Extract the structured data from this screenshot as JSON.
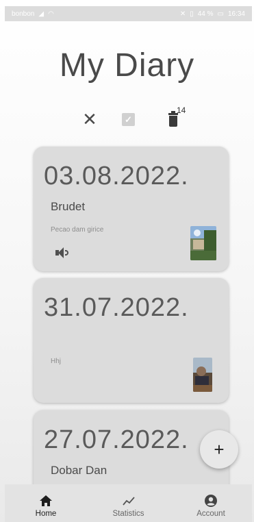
{
  "status_bar": {
    "carrier": "bonbon",
    "battery": "44 %",
    "time": "16:34"
  },
  "page": {
    "title": "My Diary"
  },
  "toolbar": {
    "close_icon": "close-icon",
    "select_all_icon": "checkbox-icon",
    "delete_icon": "trash-icon",
    "delete_count": "14"
  },
  "entries": [
    {
      "date": "03.08.2022.",
      "title": "Brudet",
      "text": "Pecao dam girice",
      "has_audio": true,
      "has_image": true
    },
    {
      "date": "31.07.2022.",
      "title": "",
      "text": "Hhj",
      "has_audio": false,
      "has_image": true
    },
    {
      "date": "27.07.2022.",
      "title": "Dobar Dan",
      "text": "",
      "has_audio": false,
      "has_image": false
    }
  ],
  "fab": {
    "label": "+"
  },
  "bottom_nav": {
    "items": [
      {
        "label": "Home",
        "icon": "home-icon",
        "active": true
      },
      {
        "label": "Statistics",
        "icon": "chart-line-icon",
        "active": false
      },
      {
        "label": "Account",
        "icon": "account-circle-icon",
        "active": false
      }
    ]
  },
  "colors": {
    "card_bg": "#dcdcdc",
    "nav_bg": "#e3e3e3",
    "status_bar_bg": "#dcdcdc"
  }
}
